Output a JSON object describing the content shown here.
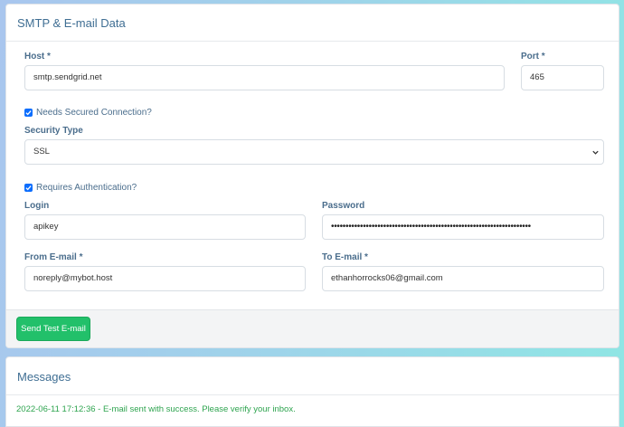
{
  "smtp_card": {
    "title": "SMTP & E-mail Data",
    "host": {
      "label": "Host *",
      "value": "smtp.sendgrid.net"
    },
    "port": {
      "label": "Port *",
      "value": "465"
    },
    "secured_connection": {
      "label": "Needs Secured Connection?",
      "checked": true
    },
    "security_type": {
      "label": "Security Type",
      "value": "SSL"
    },
    "requires_auth": {
      "label": "Requires Authentication?",
      "checked": true
    },
    "login": {
      "label": "Login",
      "value": "apikey"
    },
    "password": {
      "label": "Password",
      "value": "•••••••••••••••••••••••••••••••••••••••••••••••••••••••••••••••••••••"
    },
    "from_email": {
      "label": "From E-mail *",
      "value": "noreply@mybot.host"
    },
    "to_email": {
      "label": "To E-mail *",
      "value": "ethanhorrocks06@gmail.com"
    },
    "send_button": "Send Test E-mail"
  },
  "messages_card": {
    "title": "Messages",
    "messages": [
      "2022-06-11 17:12:36 - E-mail sent with success. Please verify your inbox."
    ]
  },
  "colors": {
    "accent": "#0d6efd",
    "success_button": "#22c06a",
    "success_text": "#2ea44f",
    "label": "#4a6d8c",
    "title": "#3f6e93"
  }
}
